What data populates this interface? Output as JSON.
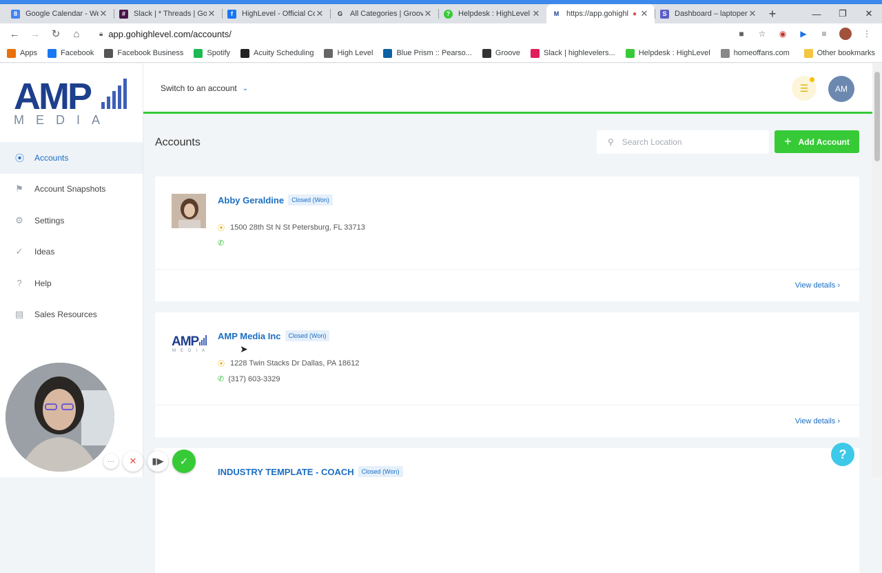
{
  "browser": {
    "tabs": [
      {
        "title": "Google Calendar - Wee",
        "favicon_color": "#4285f4",
        "favicon_glyph": "8"
      },
      {
        "title": "Slack | * Threads | GoHi",
        "favicon_color": "#4a154b",
        "favicon_glyph": "#"
      },
      {
        "title": "HighLevel - Official Co",
        "favicon_color": "#1877f2",
        "favicon_glyph": "f"
      },
      {
        "title": "All Categories | Groove",
        "favicon_color": "#ffffff",
        "favicon_glyph": "G"
      },
      {
        "title": "Helpdesk : HighLevel",
        "favicon_color": "#37ca37",
        "favicon_glyph": "?"
      },
      {
        "title": "https://app.gohighl",
        "favicon_color": "#1b3f8f",
        "favicon_glyph": "M"
      },
      {
        "title": "Dashboard – laptopen",
        "favicon_color": "#5b5fc7",
        "favicon_glyph": "S"
      }
    ],
    "url": "app.gohighlevel.com/accounts/",
    "bookmarks": [
      {
        "label": "Apps",
        "color": "#e8710a"
      },
      {
        "label": "Facebook",
        "color": "#1877f2"
      },
      {
        "label": "Facebook Business",
        "color": "#555555"
      },
      {
        "label": "Spotify",
        "color": "#1db954"
      },
      {
        "label": "Acuity Scheduling",
        "color": "#222222"
      },
      {
        "label": "High Level",
        "color": "#666666"
      },
      {
        "label": "Blue Prism :: Pearso...",
        "color": "#0b62a5"
      },
      {
        "label": "Groove",
        "color": "#333333"
      },
      {
        "label": "Slack | highlevelers...",
        "color": "#e01e5a"
      },
      {
        "label": "Helpdesk : HighLevel",
        "color": "#37ca37"
      },
      {
        "label": "homeoffans.com",
        "color": "#888888"
      }
    ],
    "other_bookmarks": "Other bookmarks"
  },
  "logo": {
    "top": "AMP",
    "bottom": "M E D I A"
  },
  "sidebar": {
    "items": [
      {
        "label": "Accounts",
        "icon": "location-pin-icon",
        "glyph": "⦿"
      },
      {
        "label": "Account Snapshots",
        "icon": "flag-icon",
        "glyph": "⚑"
      },
      {
        "label": "Settings",
        "icon": "gear-icon",
        "glyph": "⚙"
      },
      {
        "label": "Ideas",
        "icon": "check-circle-icon",
        "glyph": "✓"
      },
      {
        "label": "Help",
        "icon": "question-icon",
        "glyph": "?"
      },
      {
        "label": "Sales Resources",
        "icon": "document-icon",
        "glyph": "▤"
      }
    ]
  },
  "header": {
    "switch_label": "Switch to an account",
    "avatar_initials": "AM"
  },
  "main": {
    "title": "Accounts",
    "search_placeholder": "Search Location",
    "add_button": "Add Account",
    "accounts": [
      {
        "name": "Abby Geraldine",
        "status": "Closed (Won)",
        "address": "1500 28th St N St Petersburg, FL 33713",
        "phone": "",
        "view_details": "View details"
      },
      {
        "name": "AMP Media Inc",
        "status": "Closed (Won)",
        "address": "1228 Twin Stacks Dr Dallas, PA 18612",
        "phone": "(317) 603-3329",
        "view_details": "View details"
      },
      {
        "name": "INDUSTRY TEMPLATE - COACH",
        "status": "Closed (Won)",
        "address": "",
        "phone": "",
        "view_details": ""
      }
    ]
  },
  "colors": {
    "accent_blue": "#1b6ec2",
    "accent_green": "#37ca37",
    "help_cyan": "#3ec9e8"
  }
}
